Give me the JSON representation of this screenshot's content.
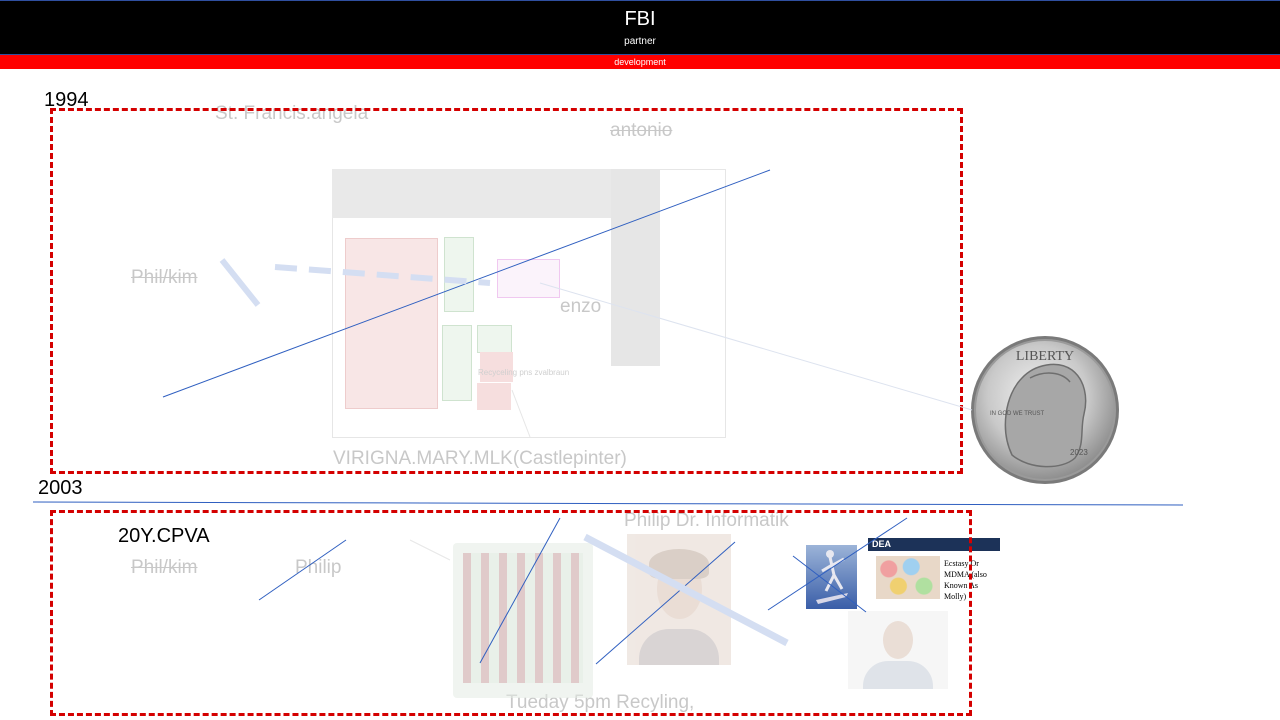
{
  "header": {
    "title": "FBI",
    "subtitle": "partner",
    "bar_label": "development"
  },
  "section1": {
    "year": "1994",
    "labels": {
      "top_left": "St. Francis.angela",
      "top_right": "antonio",
      "left": "Phil/kim",
      "middle": "enzo",
      "bottom": "VIRIGNA.MARY.MLK(Castlepinter)",
      "plan_inner": "Recyceling pns zvalbraun"
    }
  },
  "section2": {
    "year": "2003",
    "heading": "20Y.CPVA",
    "labels": {
      "left_strike": "Phil/kim",
      "left": "Philip",
      "top": "Philip Dr. Informatik",
      "bottom": "Tueday 5pm Recyling,"
    },
    "dea_card": {
      "brand": "DEA",
      "caption": "Ecstasy Or MDMA (also Known As Molly)"
    }
  },
  "coin": {
    "text_top": "LIBERTY",
    "motto": "IN GOD WE TRUST",
    "year": "2023"
  },
  "colors": {
    "header_bg": "#000000",
    "bar_bg": "#ff0000",
    "dashed_box": "#d40000",
    "line_blue": "#2f5fc0"
  }
}
